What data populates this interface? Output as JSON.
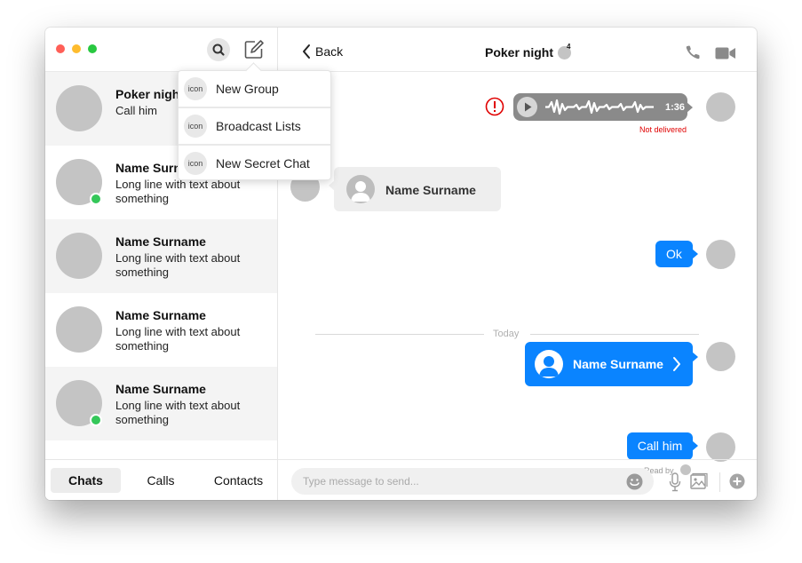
{
  "sidebar": {
    "chats": [
      {
        "name": "Poker night",
        "preview": "Call him",
        "online": false
      },
      {
        "name": "Name Surname",
        "preview": "Long line with text about something",
        "online": true
      },
      {
        "name": "Name Surname",
        "preview": "Long line with text about something",
        "online": false
      },
      {
        "name": "Name Surname",
        "preview": "Long line with text about something",
        "online": false
      },
      {
        "name": "Name Surname",
        "preview": "Long line with text about something",
        "online": true
      }
    ],
    "tabs": {
      "chats": "Chats",
      "calls": "Calls",
      "contacts": "Contacts"
    }
  },
  "menu": {
    "items": [
      {
        "icon_text": "icon",
        "label": "New Group"
      },
      {
        "icon_text": "icon",
        "label": "Broadcast Lists"
      },
      {
        "icon_text": "icon",
        "label": "New Secret Chat"
      }
    ]
  },
  "conversation": {
    "back_label": "Back",
    "title": "Poker night",
    "participant_count": "4",
    "voice_duration": "1:36",
    "not_delivered": "Not delivered",
    "contact_card_received": "Name Surname",
    "ok_message": "Ok",
    "divider": "Today",
    "contact_card_sent": "Name Surname",
    "call_message": "Call him",
    "read_by": "Read by"
  },
  "composer": {
    "placeholder": "Type message to send..."
  },
  "colors": {
    "accent": "#0a84ff",
    "error": "#e00000",
    "online": "#34c759"
  },
  "icons": [
    "search-icon",
    "compose-icon",
    "back-chevron-icon",
    "phone-icon",
    "video-icon",
    "play-icon",
    "alert-icon",
    "person-icon",
    "chevron-right-icon",
    "emoji-icon",
    "microphone-icon",
    "image-icon",
    "plus-icon"
  ]
}
